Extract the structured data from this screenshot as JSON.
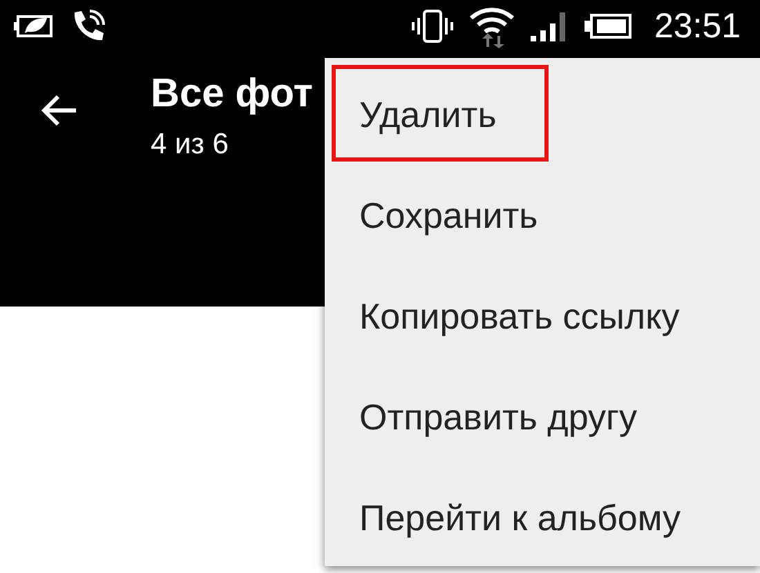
{
  "status_bar": {
    "time": "23:51"
  },
  "header": {
    "title": "Все фот",
    "subtitle": "4 из 6"
  },
  "menu": {
    "items": [
      {
        "label": "Удалить",
        "highlighted": true
      },
      {
        "label": "Сохранить",
        "highlighted": false
      },
      {
        "label": "Копировать ссылку",
        "highlighted": false
      },
      {
        "label": "Отправить другу",
        "highlighted": false
      },
      {
        "label": "Перейти к альбому",
        "highlighted": false
      }
    ]
  }
}
